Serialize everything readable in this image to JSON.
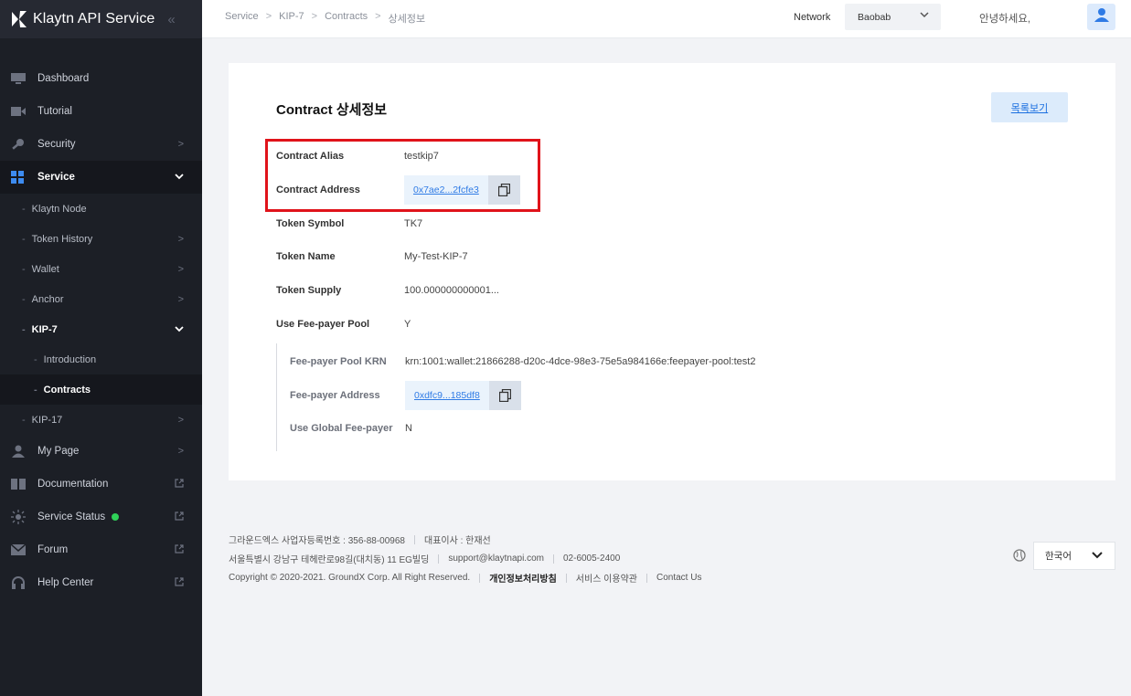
{
  "brand": {
    "name": "Klaytn API Service"
  },
  "sidebar": {
    "dashboard": "Dashboard",
    "tutorial": "Tutorial",
    "security": "Security",
    "service": "Service",
    "klaytn_node": "Klaytn Node",
    "token_history": "Token History",
    "wallet": "Wallet",
    "anchor": "Anchor",
    "kip7": "KIP-7",
    "introduction": "Introduction",
    "contracts": "Contracts",
    "kip17": "KIP-17",
    "my_page": "My Page",
    "documentation": "Documentation",
    "service_status": "Service Status",
    "forum": "Forum",
    "help_center": "Help Center"
  },
  "header": {
    "breadcrumb": [
      "Service",
      "KIP-7",
      "Contracts",
      "상세정보"
    ],
    "network_label": "Network",
    "network_value": "Baobab",
    "greeting": "안녕하세요,"
  },
  "main": {
    "title": "Contract 상세정보",
    "list_button": "목록보기",
    "fields": {
      "alias_label": "Contract Alias",
      "alias_value": "testkip7",
      "address_label": "Contract Address",
      "address_value": "0x7ae2...2fcfe3",
      "symbol_label": "Token Symbol",
      "symbol_value": "TK7",
      "name_label": "Token Name",
      "name_value": "My-Test-KIP-7",
      "supply_label": "Token Supply",
      "supply_value": "100.000000000001...",
      "feepayer_label": "Use Fee-payer Pool",
      "feepayer_value": "Y",
      "pool_krn_label": "Fee-payer Pool KRN",
      "pool_krn_value": "krn:1001:wallet:21866288-d20c-4dce-98e3-75e5a984166e:feepayer-pool:test2",
      "fee_address_label": "Fee-payer Address",
      "fee_address_value": "0xdfc9...185df8",
      "global_label": "Use Global Fee-payer",
      "global_value": "N"
    }
  },
  "footer": {
    "company": "그라운드엑스 사업자등록번호 : 356-88-00968",
    "ceo": "대표이사 : 한재선",
    "address": "서울특별시 강남구 테헤란로98길(대치동) 11 EG빌딩",
    "email": "support@klaytnapi.com",
    "phone": "02-6005-2400",
    "copyright": "Copyright © 2020-2021. GroundX Corp. All Right Reserved.",
    "privacy": "개인정보처리방침",
    "terms": "서비스 이용약관",
    "contact": "Contact Us",
    "language": "한국어"
  },
  "colors": {
    "sidebar_bg": "#1c1f26",
    "accent": "#2f7be5",
    "highlight": "#e0131a",
    "status": "#2fd158"
  }
}
